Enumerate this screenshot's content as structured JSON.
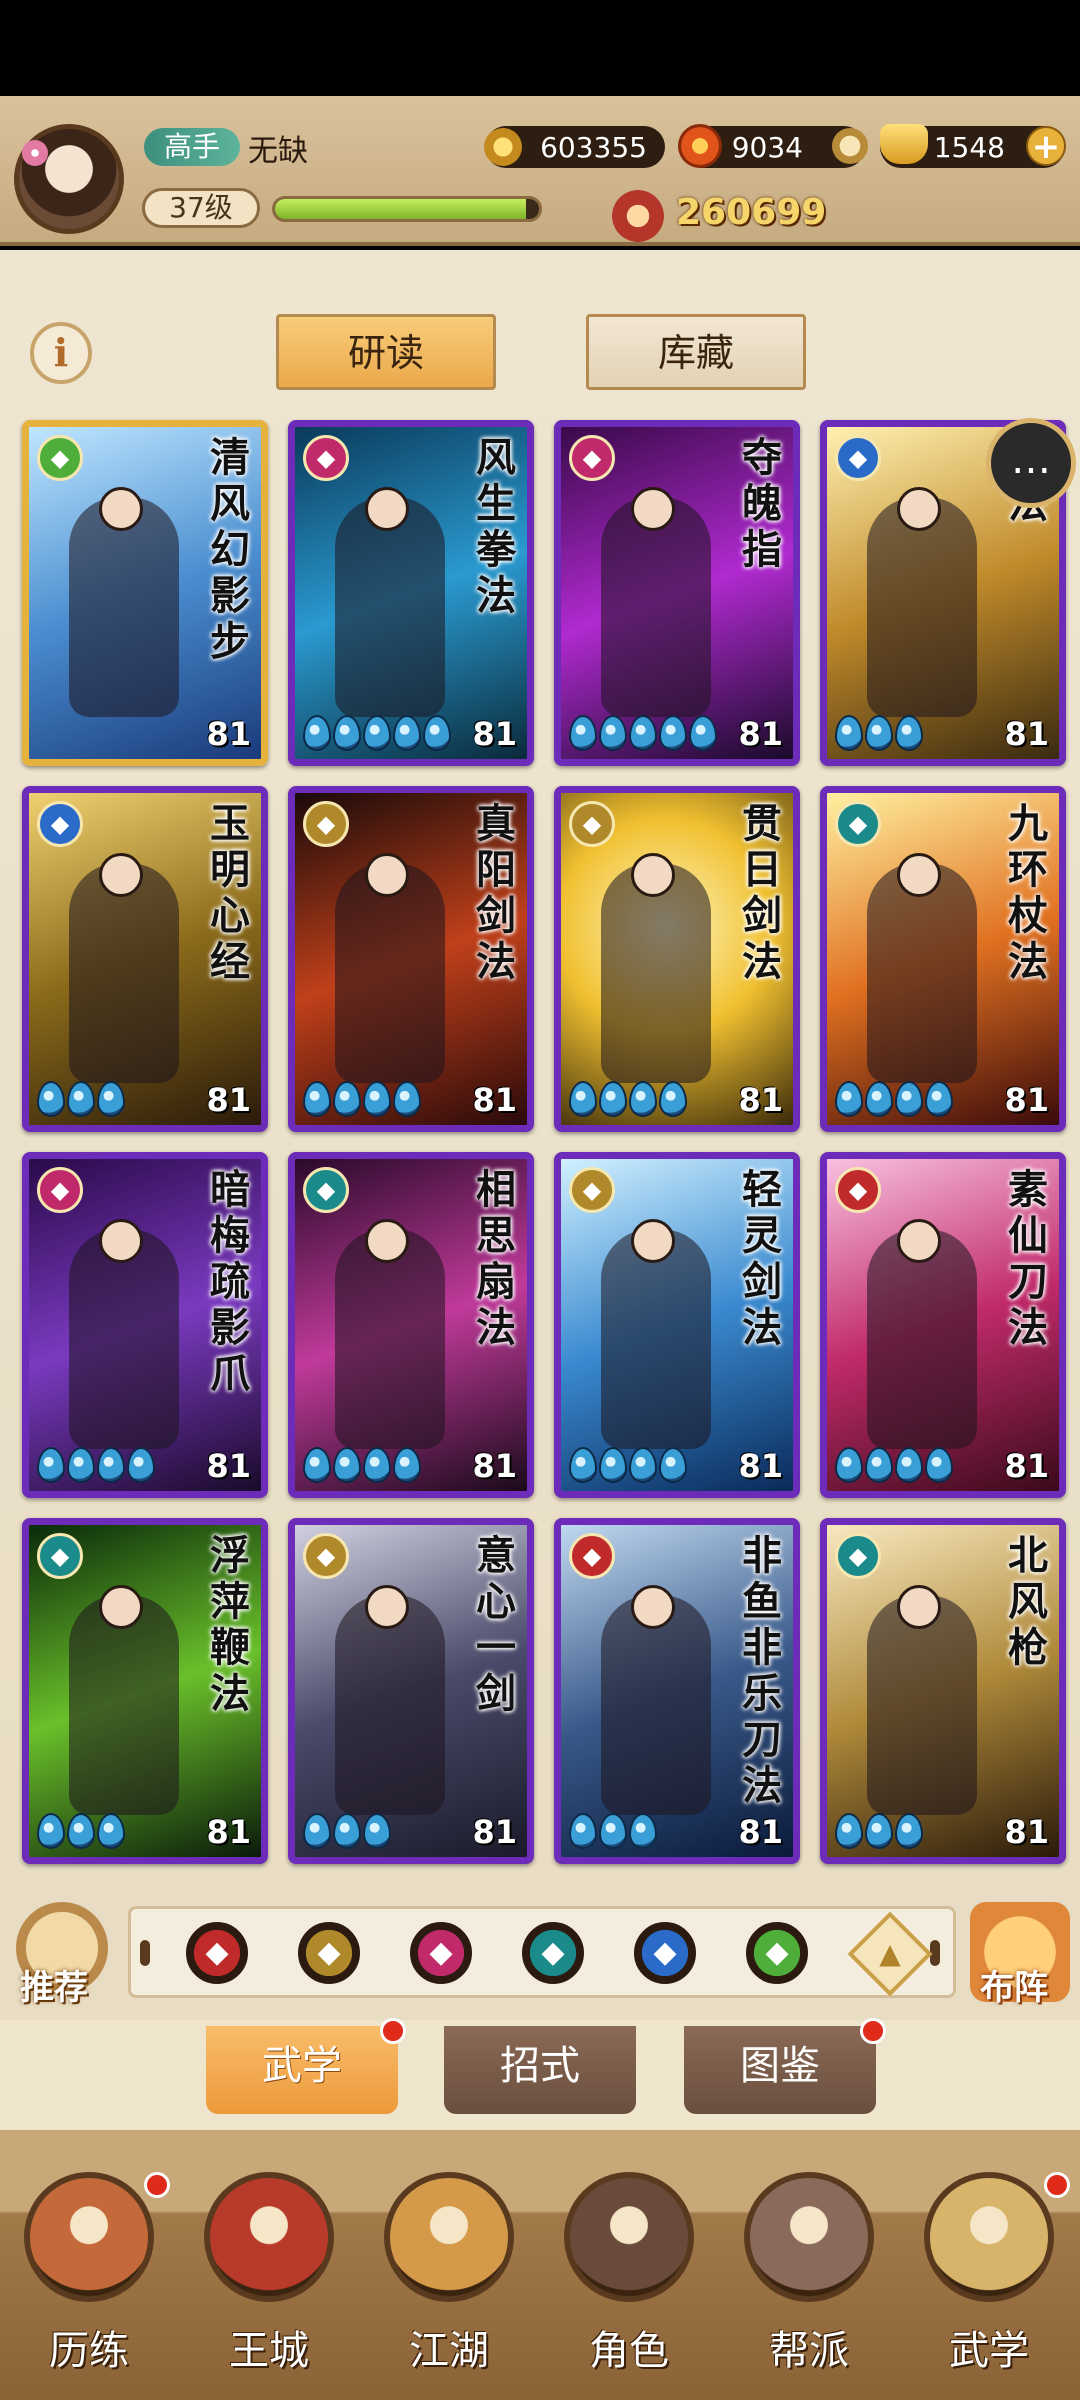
{
  "header": {
    "rank_badge": "高手",
    "player_name": "无缺",
    "level": "37级",
    "exp_fraction": 0.95,
    "coins": "603355",
    "gems": "9034",
    "gold": "1548",
    "power": "260699"
  },
  "top_tabs": {
    "study": "研读",
    "storage": "库藏"
  },
  "cards": [
    {
      "name": "清风幻影步",
      "level": "81",
      "drops": 0,
      "rarity": "gold",
      "badge_color": "#4fae3a"
    },
    {
      "name": "风生拳法",
      "level": "81",
      "drops": 5,
      "rarity": "purple",
      "badge_color": "#c02a6a"
    },
    {
      "name": "夺魄指",
      "level": "81",
      "drops": 5,
      "rarity": "purple",
      "badge_color": "#c02a6a"
    },
    {
      "name": "心法",
      "level": "81",
      "drops": 3,
      "rarity": "purple",
      "badge_color": "#2a6ac8"
    },
    {
      "name": "玉明心经",
      "level": "81",
      "drops": 3,
      "rarity": "purple",
      "badge_color": "#2a6ac8"
    },
    {
      "name": "真阳剑法",
      "level": "81",
      "drops": 4,
      "rarity": "purple",
      "badge_color": "#b08a2a"
    },
    {
      "name": "贯日剑法",
      "level": "81",
      "drops": 4,
      "rarity": "purple",
      "badge_color": "#b08a2a"
    },
    {
      "name": "九环杖法",
      "level": "81",
      "drops": 4,
      "rarity": "purple",
      "badge_color": "#1a8a8a"
    },
    {
      "name": "暗梅疏影爪",
      "level": "81",
      "drops": 4,
      "rarity": "purple",
      "badge_color": "#c02a6a"
    },
    {
      "name": "相思扇法",
      "level": "81",
      "drops": 4,
      "rarity": "purple",
      "badge_color": "#1a8a8a"
    },
    {
      "name": "轻灵剑法",
      "level": "81",
      "drops": 4,
      "rarity": "purple",
      "badge_color": "#b08a2a"
    },
    {
      "name": "素仙刀法",
      "level": "81",
      "drops": 4,
      "rarity": "purple",
      "badge_color": "#c02a2a"
    },
    {
      "name": "浮萍鞭法",
      "level": "81",
      "drops": 3,
      "rarity": "purple",
      "badge_color": "#1a8a8a"
    },
    {
      "name": "意心一剑",
      "level": "81",
      "drops": 3,
      "rarity": "purple",
      "badge_color": "#b08a2a"
    },
    {
      "name": "非鱼非乐刀法",
      "level": "81",
      "drops": 3,
      "rarity": "purple",
      "badge_color": "#c02a2a"
    },
    {
      "name": "北风枪",
      "level": "81",
      "drops": 3,
      "rarity": "purple",
      "badge_color": "#1a8a8a"
    }
  ],
  "filters": [
    {
      "icon": "blade-icon",
      "color": "#c02a2a"
    },
    {
      "icon": "sword-icon",
      "color": "#b08a2a"
    },
    {
      "icon": "fist-icon",
      "color": "#c02a6a"
    },
    {
      "icon": "fan-icon",
      "color": "#1a8a8a"
    },
    {
      "icon": "yinyang-icon",
      "color": "#2a6ac8"
    },
    {
      "icon": "swirl-icon",
      "color": "#4fae3a"
    }
  ],
  "side_buttons": {
    "recommend": "推荐",
    "formation": "布阵"
  },
  "sub_tabs": {
    "skills": "武学",
    "moves": "招式",
    "atlas": "图鉴"
  },
  "bottom_nav": [
    {
      "label": "历练",
      "color": "#c46a3a",
      "badge": true
    },
    {
      "label": "王城",
      "color": "#b83a2a",
      "badge": false
    },
    {
      "label": "江湖",
      "color": "#d49a4a",
      "badge": false
    },
    {
      "label": "角色",
      "color": "#6a4a3a",
      "badge": false
    },
    {
      "label": "帮派",
      "color": "#8a6a5a",
      "badge": false
    },
    {
      "label": "武学",
      "color": "#d8b46a",
      "badge": true
    }
  ]
}
